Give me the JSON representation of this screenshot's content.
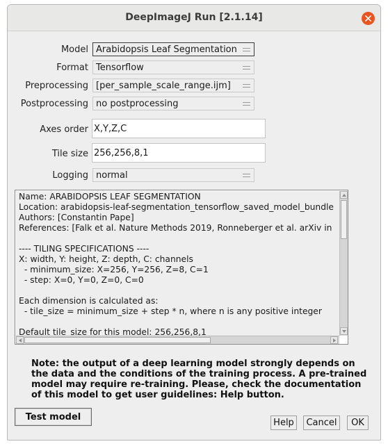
{
  "window": {
    "title": "DeepImageJ Run [2.1.14]"
  },
  "form": {
    "model_label": "Model",
    "model_value": "Arabidopsis Leaf Segmentation",
    "format_label": "Format",
    "format_value": "Tensorflow",
    "preprocessing_label": "Preprocessing",
    "preprocessing_value": "[per_sample_scale_range.ijm]",
    "postprocessing_label": "Postprocessing",
    "postprocessing_value": "no postprocessing",
    "axes_order_label": "Axes order",
    "axes_order_value": "X,Y,Z,C",
    "tile_size_label": "Tile size",
    "tile_size_value": "256,256,8,1",
    "logging_label": "Logging",
    "logging_value": "normal"
  },
  "info_text": "Name: ARABIDOPSIS LEAF SEGMENTATION\nLocation: arabidopsis-leaf-segmentation_tensorflow_saved_model_bundle\nAuthors: [Constantin Pape]\nReferences: [Falk et al. Nature Methods 2019, Ronneberger et al. arXiv in\n\n---- TILING SPECIFICATIONS ----\nX: width, Y: height, Z: depth, C: channels\n  - minimum_size: X=256, Y=256, Z=8, C=1\n  - step: X=0, Y=0, Z=0, C=0\n\nEach dimension is calculated as:\n  - tile_size = minimum_size + step * n, where n is any positive integer\n\nDefault tile_size for this model: 256,256,8,1",
  "note": "Note: the output of a deep learning model strongly depends on the data and the conditions of the training process. A pre-trained model may require re-training. Please, check the documentation of this model to get user guidelines: Help button.",
  "buttons": {
    "test_model": "Test model",
    "help": "Help",
    "cancel": "Cancel",
    "ok": "OK"
  },
  "colors": {
    "close_button": "#e95420",
    "window_bg": "#eeeeee"
  },
  "icons": {
    "close": "close-icon",
    "combo_arrow": "combo-arrow-icon",
    "scroll_up": "arrow-up-icon",
    "scroll_down": "arrow-down-icon",
    "scroll_left": "arrow-left-icon",
    "scroll_right": "arrow-right-icon"
  }
}
